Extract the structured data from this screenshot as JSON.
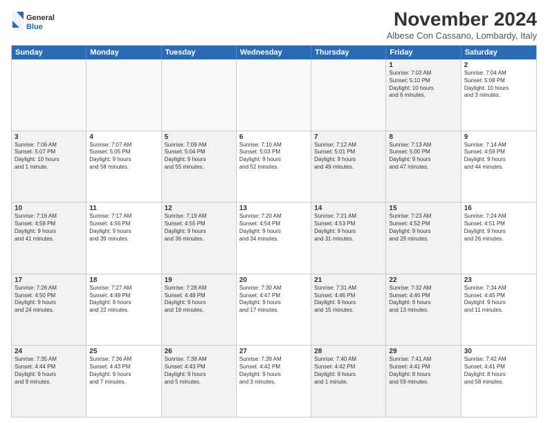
{
  "header": {
    "title": "November 2024",
    "location": "Albese Con Cassano, Lombardy, Italy"
  },
  "logo": {
    "general": "General",
    "blue": "Blue"
  },
  "days": [
    "Sunday",
    "Monday",
    "Tuesday",
    "Wednesday",
    "Thursday",
    "Friday",
    "Saturday"
  ],
  "rows": [
    [
      {
        "day": "",
        "text": "",
        "empty": true
      },
      {
        "day": "",
        "text": "",
        "empty": true
      },
      {
        "day": "",
        "text": "",
        "empty": true
      },
      {
        "day": "",
        "text": "",
        "empty": true
      },
      {
        "day": "",
        "text": "",
        "empty": true
      },
      {
        "day": "1",
        "text": "Sunrise: 7:03 AM\nSunset: 5:10 PM\nDaylight: 10 hours\nand 6 minutes.",
        "shaded": true
      },
      {
        "day": "2",
        "text": "Sunrise: 7:04 AM\nSunset: 5:08 PM\nDaylight: 10 hours\nand 3 minutes.",
        "shaded": false
      }
    ],
    [
      {
        "day": "3",
        "text": "Sunrise: 7:06 AM\nSunset: 5:07 PM\nDaylight: 10 hours\nand 1 minute.",
        "shaded": true
      },
      {
        "day": "4",
        "text": "Sunrise: 7:07 AM\nSunset: 5:05 PM\nDaylight: 9 hours\nand 58 minutes.",
        "shaded": false
      },
      {
        "day": "5",
        "text": "Sunrise: 7:09 AM\nSunset: 5:04 PM\nDaylight: 9 hours\nand 55 minutes.",
        "shaded": true
      },
      {
        "day": "6",
        "text": "Sunrise: 7:10 AM\nSunset: 5:03 PM\nDaylight: 9 hours\nand 52 minutes.",
        "shaded": false
      },
      {
        "day": "7",
        "text": "Sunrise: 7:12 AM\nSunset: 5:01 PM\nDaylight: 9 hours\nand 49 minutes.",
        "shaded": true
      },
      {
        "day": "8",
        "text": "Sunrise: 7:13 AM\nSunset: 5:00 PM\nDaylight: 9 hours\nand 47 minutes.",
        "shaded": true
      },
      {
        "day": "9",
        "text": "Sunrise: 7:14 AM\nSunset: 4:59 PM\nDaylight: 9 hours\nand 44 minutes.",
        "shaded": false
      }
    ],
    [
      {
        "day": "10",
        "text": "Sunrise: 7:16 AM\nSunset: 4:58 PM\nDaylight: 9 hours\nand 41 minutes.",
        "shaded": true
      },
      {
        "day": "11",
        "text": "Sunrise: 7:17 AM\nSunset: 4:56 PM\nDaylight: 9 hours\nand 39 minutes.",
        "shaded": false
      },
      {
        "day": "12",
        "text": "Sunrise: 7:19 AM\nSunset: 4:55 PM\nDaylight: 9 hours\nand 36 minutes.",
        "shaded": true
      },
      {
        "day": "13",
        "text": "Sunrise: 7:20 AM\nSunset: 4:54 PM\nDaylight: 9 hours\nand 34 minutes.",
        "shaded": false
      },
      {
        "day": "14",
        "text": "Sunrise: 7:21 AM\nSunset: 4:53 PM\nDaylight: 9 hours\nand 31 minutes.",
        "shaded": true
      },
      {
        "day": "15",
        "text": "Sunrise: 7:23 AM\nSunset: 4:52 PM\nDaylight: 9 hours\nand 29 minutes.",
        "shaded": true
      },
      {
        "day": "16",
        "text": "Sunrise: 7:24 AM\nSunset: 4:51 PM\nDaylight: 9 hours\nand 26 minutes.",
        "shaded": false
      }
    ],
    [
      {
        "day": "17",
        "text": "Sunrise: 7:26 AM\nSunset: 4:50 PM\nDaylight: 9 hours\nand 24 minutes.",
        "shaded": true
      },
      {
        "day": "18",
        "text": "Sunrise: 7:27 AM\nSunset: 4:49 PM\nDaylight: 9 hours\nand 22 minutes.",
        "shaded": false
      },
      {
        "day": "19",
        "text": "Sunrise: 7:28 AM\nSunset: 4:48 PM\nDaylight: 9 hours\nand 19 minutes.",
        "shaded": true
      },
      {
        "day": "20",
        "text": "Sunrise: 7:30 AM\nSunset: 4:47 PM\nDaylight: 9 hours\nand 17 minutes.",
        "shaded": false
      },
      {
        "day": "21",
        "text": "Sunrise: 7:31 AM\nSunset: 4:46 PM\nDaylight: 9 hours\nand 15 minutes.",
        "shaded": true
      },
      {
        "day": "22",
        "text": "Sunrise: 7:32 AM\nSunset: 4:46 PM\nDaylight: 9 hours\nand 13 minutes.",
        "shaded": true
      },
      {
        "day": "23",
        "text": "Sunrise: 7:34 AM\nSunset: 4:45 PM\nDaylight: 9 hours\nand 11 minutes.",
        "shaded": false
      }
    ],
    [
      {
        "day": "24",
        "text": "Sunrise: 7:35 AM\nSunset: 4:44 PM\nDaylight: 9 hours\nand 9 minutes.",
        "shaded": true
      },
      {
        "day": "25",
        "text": "Sunrise: 7:36 AM\nSunset: 4:43 PM\nDaylight: 9 hours\nand 7 minutes.",
        "shaded": false
      },
      {
        "day": "26",
        "text": "Sunrise: 7:38 AM\nSunset: 4:43 PM\nDaylight: 9 hours\nand 5 minutes.",
        "shaded": true
      },
      {
        "day": "27",
        "text": "Sunrise: 7:39 AM\nSunset: 4:42 PM\nDaylight: 9 hours\nand 3 minutes.",
        "shaded": false
      },
      {
        "day": "28",
        "text": "Sunrise: 7:40 AM\nSunset: 4:42 PM\nDaylight: 9 hours\nand 1 minute.",
        "shaded": true
      },
      {
        "day": "29",
        "text": "Sunrise: 7:41 AM\nSunset: 4:41 PM\nDaylight: 8 hours\nand 59 minutes.",
        "shaded": true
      },
      {
        "day": "30",
        "text": "Sunrise: 7:42 AM\nSunset: 4:41 PM\nDaylight: 8 hours\nand 58 minutes.",
        "shaded": false
      }
    ]
  ]
}
